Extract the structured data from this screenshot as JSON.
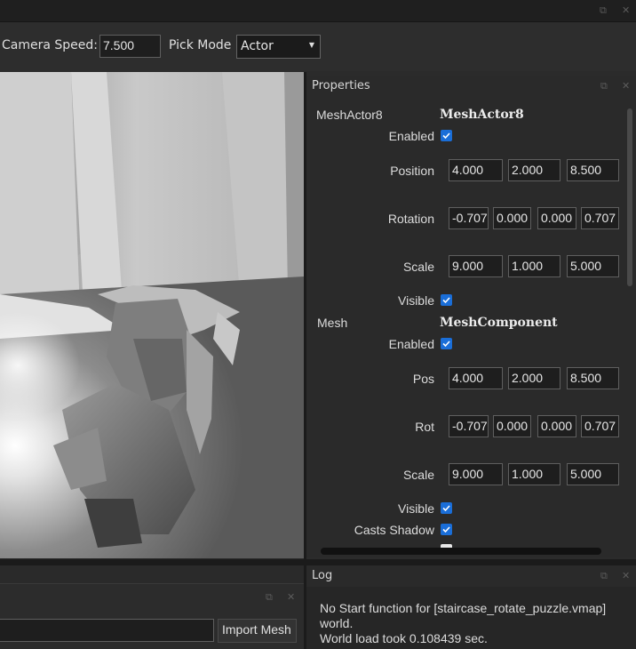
{
  "toolbar": {
    "camera_speed_label": "Camera Speed:",
    "camera_speed_value": "7.500",
    "pick_mode_label": "Pick Mode",
    "pick_mode_value": "Actor"
  },
  "properties": {
    "title": "Properties",
    "actor": {
      "name": "MeshActor8",
      "type": "MeshActor8",
      "enabled_label": "Enabled",
      "enabled": true,
      "position_label": "Position",
      "position": [
        "4.000",
        "2.000",
        "8.500"
      ],
      "rotation_label": "Rotation",
      "rotation": [
        "-0.707",
        "0.000",
        "0.000",
        "0.707"
      ],
      "scale_label": "Scale",
      "scale": [
        "9.000",
        "1.000",
        "5.000"
      ],
      "visible_label": "Visible",
      "visible": true
    },
    "component": {
      "name": "Mesh",
      "type": "MeshComponent",
      "enabled_label": "Enabled",
      "enabled": true,
      "pos_label": "Pos",
      "pos": [
        "4.000",
        "2.000",
        "8.500"
      ],
      "rot_label": "Rot",
      "rot": [
        "-0.707",
        "0.000",
        "0.000",
        "0.707"
      ],
      "scale_label": "Scale",
      "scale": [
        "9.000",
        "1.000",
        "5.000"
      ],
      "visible_label": "Visible",
      "visible": true,
      "casts_shadow_label": "Casts Shadow",
      "casts_shadow": true
    }
  },
  "log": {
    "title": "Log",
    "lines": [
      "No Start function for [staircase_rotate_puzzle.vmap]",
      "world.",
      "World load took 0.108439 sec."
    ]
  },
  "assets": {
    "import_button": "Import Mesh"
  },
  "colors": {
    "accent": "#1a6ed8",
    "panel_bg": "#2a2a2a",
    "title_bg": "#1f1f1f"
  }
}
